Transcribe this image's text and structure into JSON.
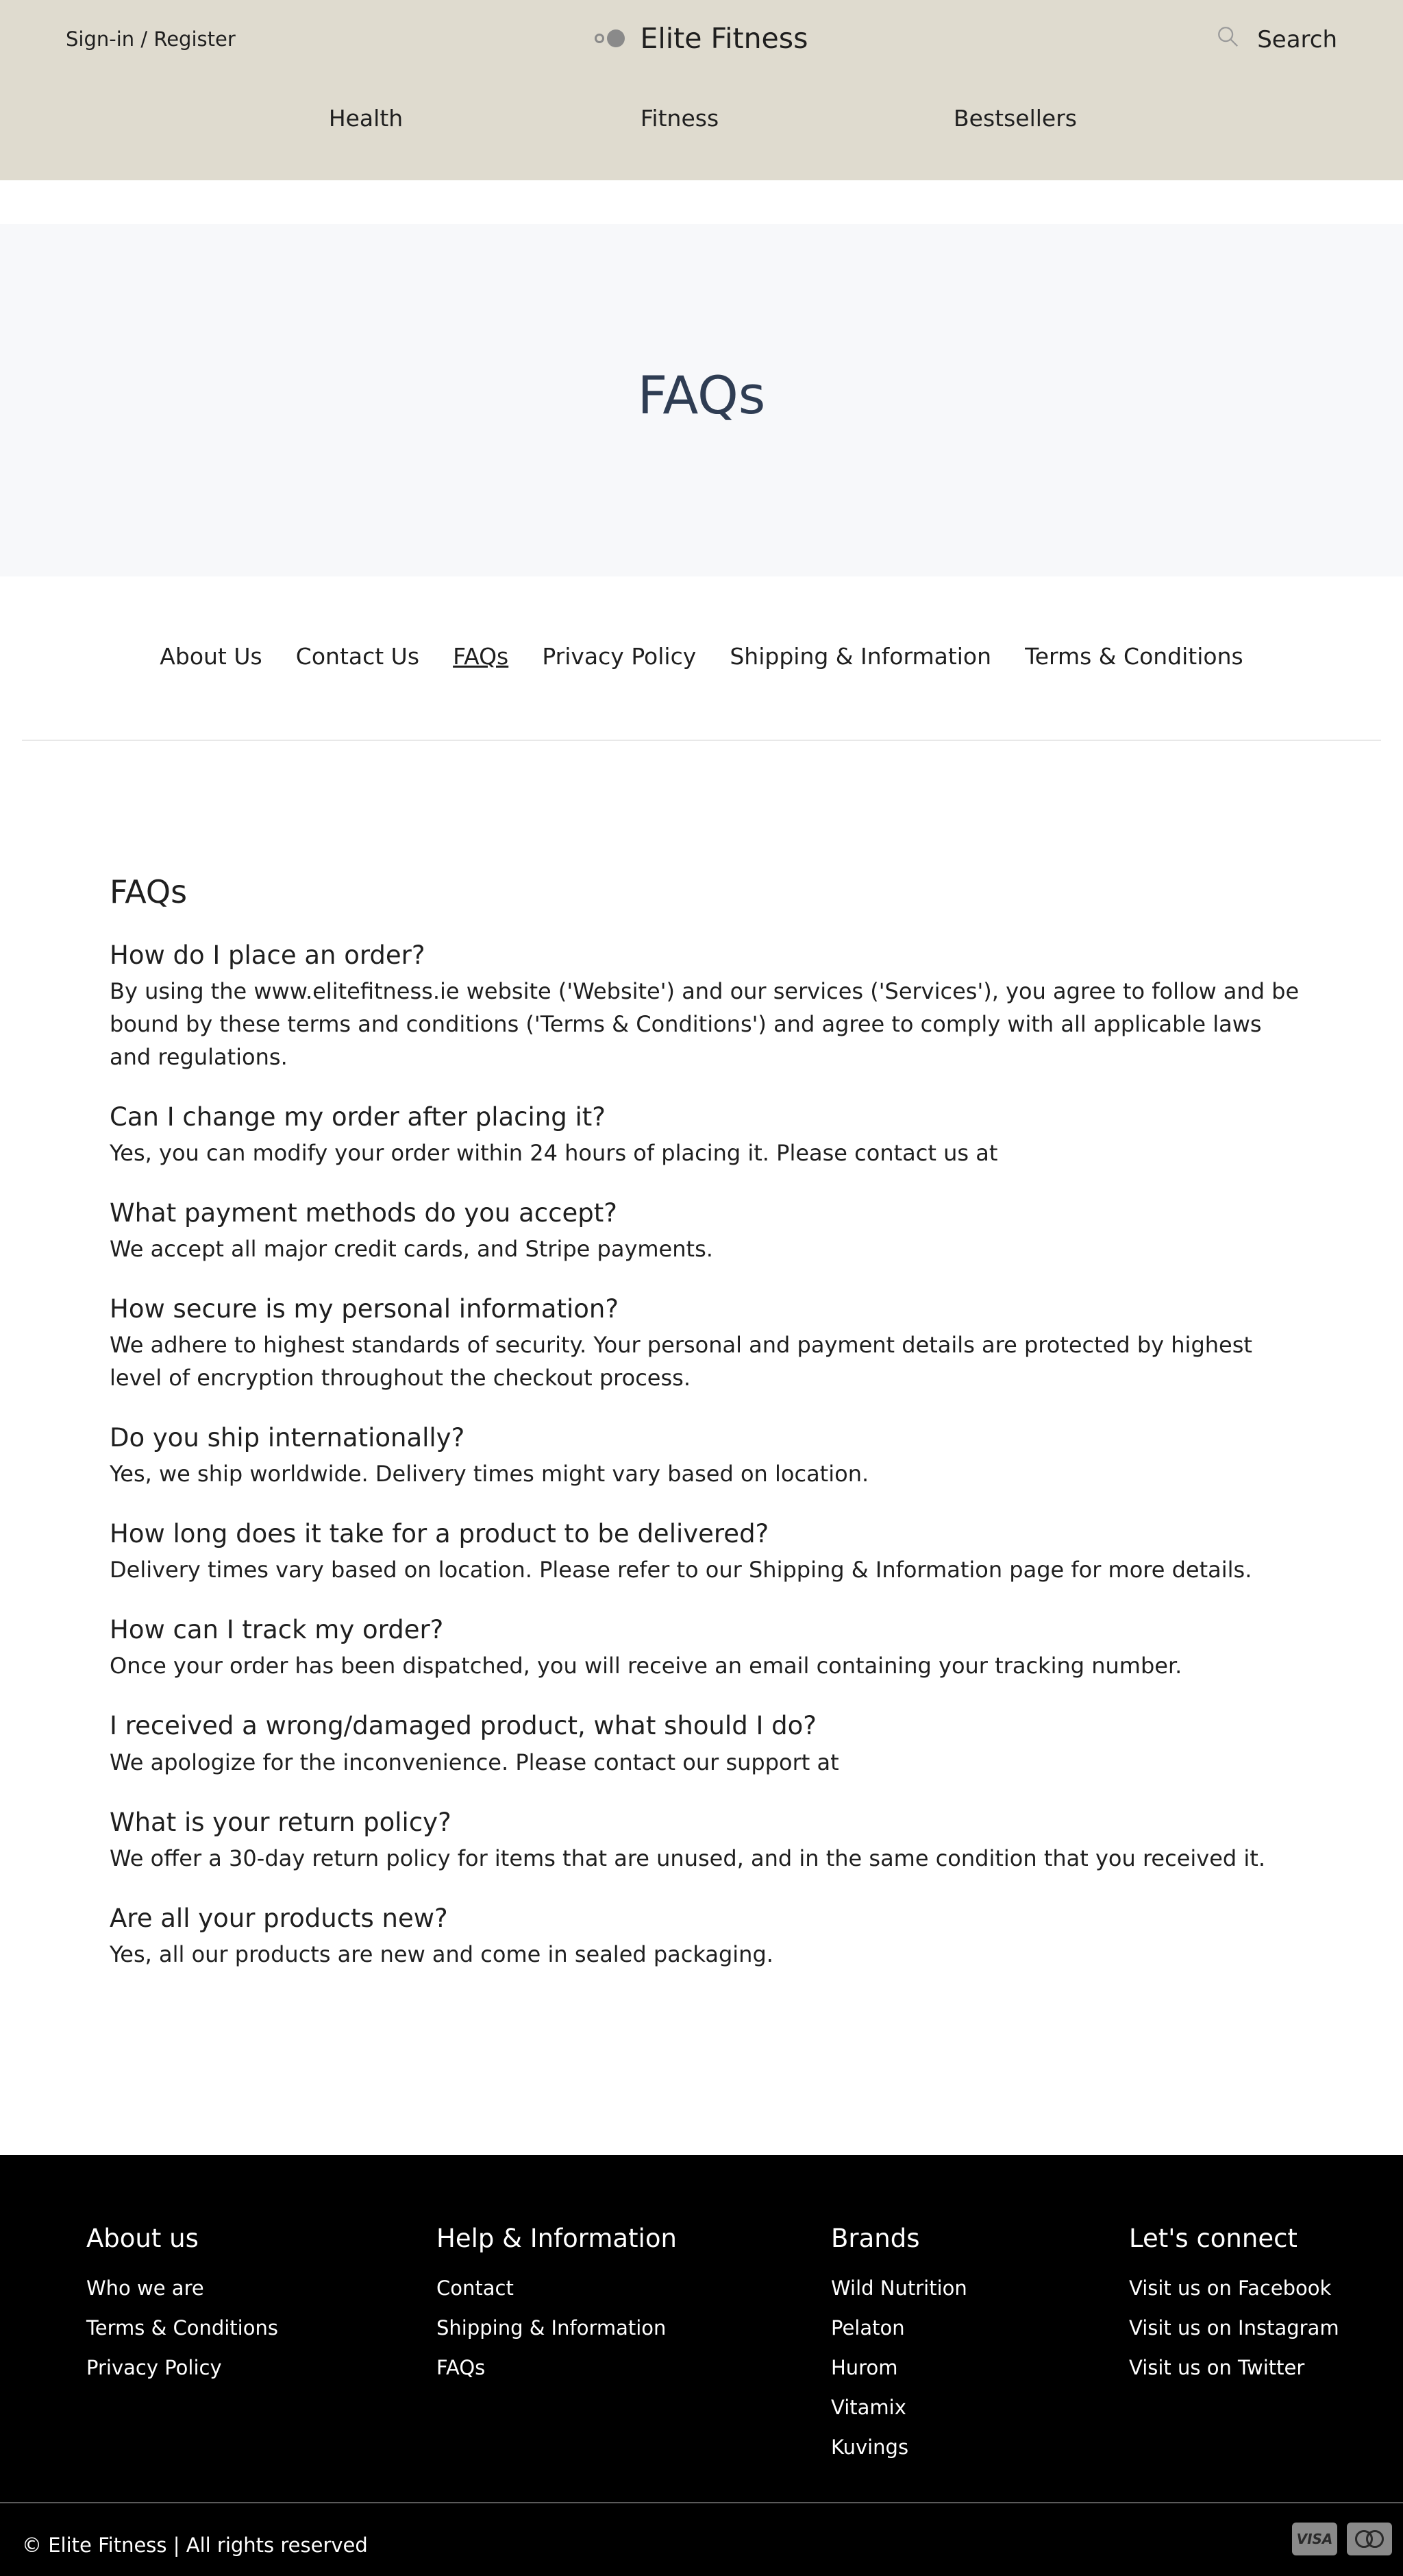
{
  "header": {
    "signin_label": "Sign-in / Register",
    "brand": "Elite Fitness",
    "search_label": "Search",
    "logo_icon": "logo-dots-icon",
    "search_icon": "search-icon",
    "background": "#dfdbcf"
  },
  "nav": {
    "items": [
      {
        "label": "Health"
      },
      {
        "label": "Fitness"
      },
      {
        "label": "Bestsellers"
      }
    ]
  },
  "hero": {
    "title": "FAQs",
    "title_color": "#2f3d53"
  },
  "page_links": {
    "items": [
      {
        "label": "About Us",
        "active": false
      },
      {
        "label": "Contact Us",
        "active": false
      },
      {
        "label": "FAQs",
        "active": true
      },
      {
        "label": "Privacy Policy",
        "active": false
      },
      {
        "label": "Shipping & Information",
        "active": false
      },
      {
        "label": "Terms & Conditions",
        "active": false
      }
    ]
  },
  "faq": {
    "heading": "FAQs",
    "items": [
      {
        "q": "How do I place an order?",
        "a": "By using the www.elitefitness.ie website ('Website') and our services ('Services'), you agree to follow and be bound by these terms and conditions ('Terms & Conditions') and agree to comply with all applicable laws and regulations."
      },
      {
        "q": "Can I change my order after placing it?",
        "a": "Yes, you can modify your order within 24 hours of placing it. Please contact us at"
      },
      {
        "q": "What payment methods do you accept?",
        "a": "We accept all major credit cards, and Stripe payments."
      },
      {
        "q": "How secure is my personal information?",
        "a": "We adhere to highest standards of security. Your personal and payment details are protected by highest level of encryption throughout the checkout process."
      },
      {
        "q": "Do you ship internationally?",
        "a": "Yes, we ship worldwide. Delivery times might vary based on location."
      },
      {
        "q": "How long does it take for a product to be delivered?",
        "a": "Delivery times vary based on location. Please refer to our Shipping & Information page for more details."
      },
      {
        "q": "How can I track my order?",
        "a": "Once your order has been dispatched, you will receive an email containing your tracking number."
      },
      {
        "q": "I received a wrong/damaged product, what should I do?",
        "a": "We apologize for the inconvenience. Please contact our support at"
      },
      {
        "q": "What is your return policy?",
        "a": "We offer a 30-day return policy for items that are unused, and in the same condition that you received it."
      },
      {
        "q": "Are all your products new?",
        "a": "Yes, all our products are new and come in sealed packaging."
      }
    ]
  },
  "footer": {
    "columns": [
      {
        "title": "About us",
        "links": [
          "Who we are",
          "Terms & Conditions",
          "Privacy Policy"
        ]
      },
      {
        "title": "Help & Information",
        "links": [
          "Contact",
          "Shipping & Information",
          "FAQs"
        ]
      },
      {
        "title": "Brands",
        "links": [
          "Wild Nutrition",
          "Pelaton",
          "Hurom",
          "Vitamix",
          "Kuvings"
        ]
      },
      {
        "title": "Let's connect",
        "links": [
          "Visit us on Facebook",
          "Visit us on Instagram",
          "Visit us on Twitter"
        ]
      }
    ],
    "copyright": "© Elite Fitness | All rights reserved",
    "payment_cards": [
      {
        "icon": "visa-card-icon",
        "label": "VISA"
      },
      {
        "icon": "mastercard-icon",
        "label": ""
      }
    ],
    "background": "#000000"
  }
}
